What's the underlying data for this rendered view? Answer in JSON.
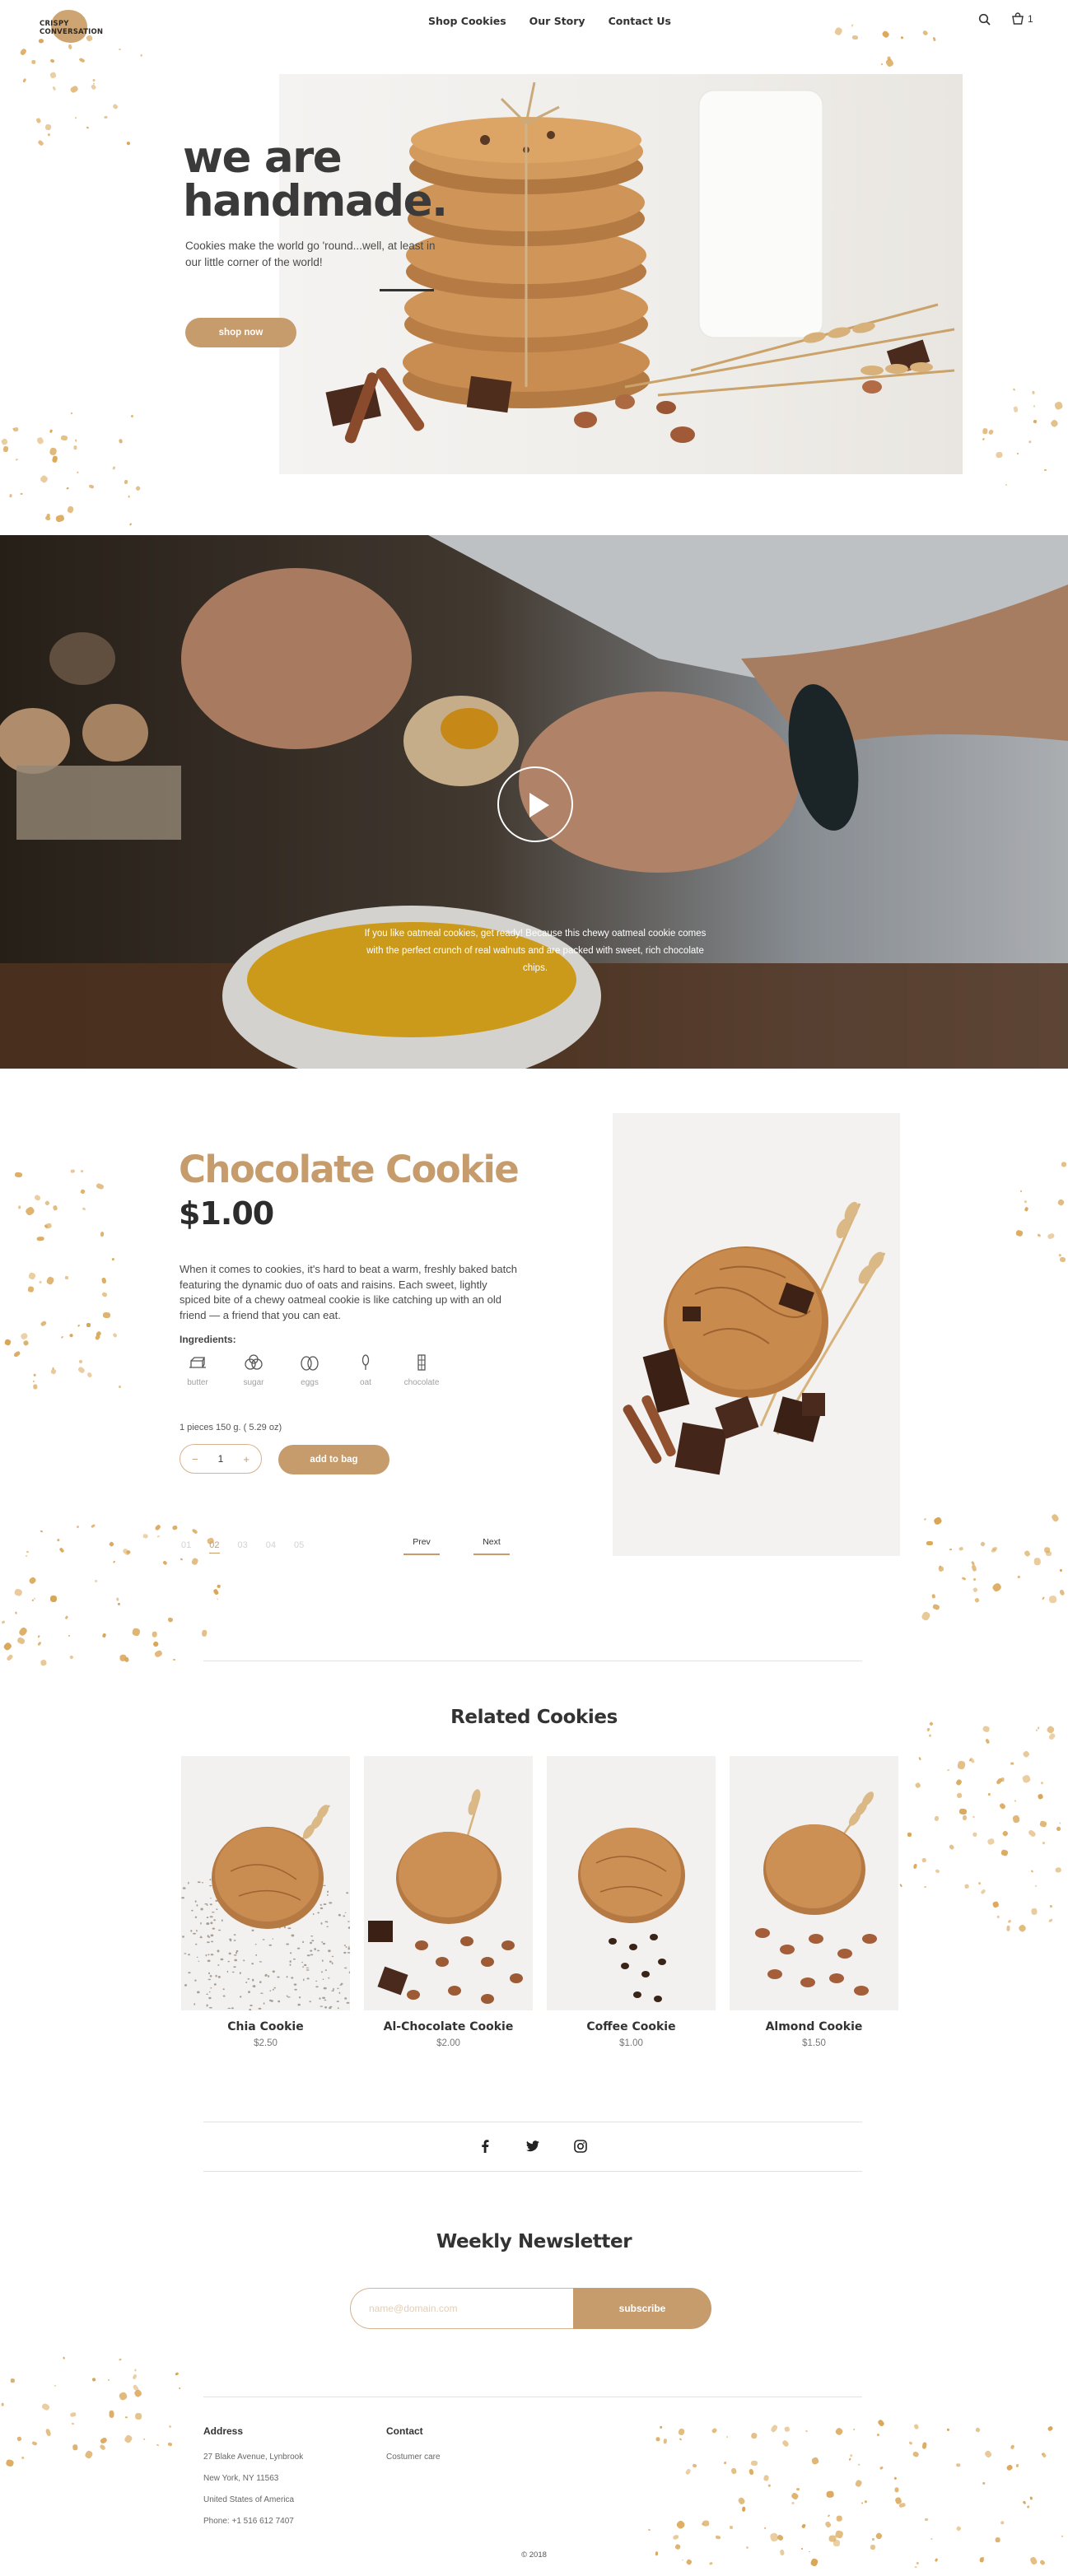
{
  "brand": {
    "line1": "CRISPY",
    "line2": "CONVERSATION"
  },
  "nav": {
    "items": [
      "Shop Cookies",
      "Our Story",
      "Contact Us"
    ]
  },
  "header": {
    "cart_count": "1"
  },
  "hero": {
    "title_line1": "we are",
    "title_line2": "handmade.",
    "subtitle": "Cookies make the world go 'round...well, at least in our little corner of the world!",
    "button": "shop now"
  },
  "video": {
    "caption": "If you like oatmeal cookies, get ready! Because this chewy oatmeal cookie comes with the perfect crunch of real walnuts and are packed with sweet, rich chocolate chips."
  },
  "product": {
    "name": "Chocolate Cookie",
    "price": "$1.00",
    "description": "When it comes to cookies, it's hard to beat a warm, freshly baked batch featuring the dynamic duo of oats and raisins. Each sweet, lightly spiced bite of a chewy oatmeal cookie is like catching up with an old friend — a friend that you  can eat.",
    "ingredients_label": "Ingredients:",
    "ingredients": [
      {
        "label": "butter",
        "icon": "butter-icon"
      },
      {
        "label": "sugar",
        "icon": "sugar-icon"
      },
      {
        "label": "eggs",
        "icon": "eggs-icon"
      },
      {
        "label": "oat",
        "icon": "oat-icon"
      },
      {
        "label": "chocolate",
        "icon": "chocolate-icon"
      }
    ],
    "weight": "1 pieces 150 g. ( 5.29 oz)",
    "quantity": "1",
    "minus": "−",
    "plus": "+",
    "add_button": "add to bag",
    "pages": [
      "01",
      "02",
      "03",
      "04",
      "05"
    ],
    "active_page": "02",
    "prev": "Prev",
    "next": "Next"
  },
  "related": {
    "title": "Related Cookies",
    "items": [
      {
        "name": "Chia Cookie",
        "price": "$2.50"
      },
      {
        "name": "Al-Chocolate Cookie",
        "price": "$2.00"
      },
      {
        "name": "Coffee Cookie",
        "price": "$1.00"
      },
      {
        "name": "Almond Cookie",
        "price": "$1.50"
      }
    ]
  },
  "social": {
    "icons": [
      "facebook-icon",
      "twitter-icon",
      "instagram-icon"
    ]
  },
  "newsletter": {
    "title": "Weekly Newsletter",
    "placeholder": "name@domain.com",
    "button": "subscribe"
  },
  "footer": {
    "address_heading": "Address",
    "address_lines": [
      "27 Blake Avenue, Lynbrook",
      "New York, NY 11563",
      "United States of America",
      "Phone: +1 516 612 7407"
    ],
    "contact_heading": "Contact",
    "contact_lines": [
      "Costumer care"
    ],
    "copyright": "© 2018"
  },
  "colors": {
    "accent": "#c69c6d",
    "text": "#333333",
    "crumb": "#d9a555"
  }
}
